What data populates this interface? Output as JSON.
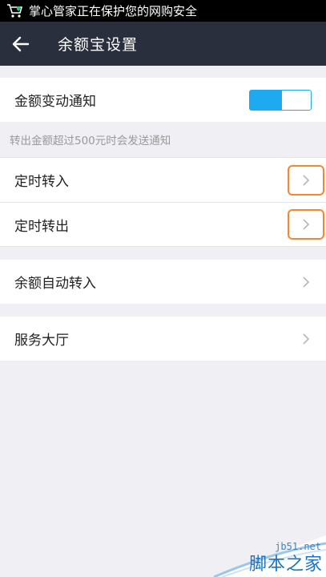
{
  "status_bar": {
    "text": "掌心管家正在保护您的网购安全",
    "icon": "shopping-cart-shield-icon"
  },
  "header": {
    "title": "余额宝设置",
    "back_icon": "back-arrow-icon"
  },
  "notify": {
    "label": "金额变动通知",
    "toggle_on": true,
    "hint": "转出金额超过500元时会发送通知"
  },
  "schedule": {
    "items": [
      {
        "label": "定时转入",
        "icon": "chevron-right-icon"
      },
      {
        "label": "定时转出",
        "icon": "chevron-right-icon"
      }
    ]
  },
  "auto": {
    "label": "余额自动转入",
    "icon": "chevron-right-icon"
  },
  "service": {
    "label": "服务大厅",
    "icon": "chevron-right-icon"
  },
  "watermark": {
    "url": "jb51.net",
    "name": "脚本之家"
  },
  "colors": {
    "accent": "#1eaaf1",
    "header_bg": "#2a2f3d",
    "highlight": "#f7862d",
    "page_bg": "#efeff4"
  }
}
